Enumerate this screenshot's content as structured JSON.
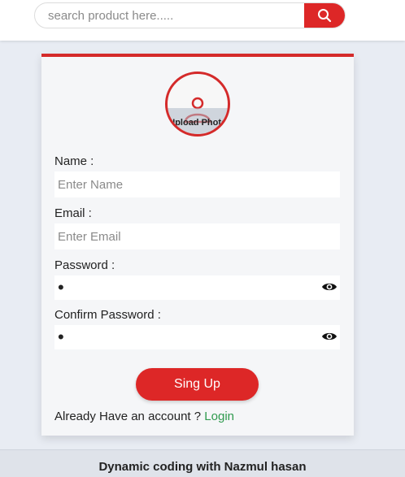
{
  "header": {
    "search": {
      "placeholder": "search product here....."
    }
  },
  "icons": {
    "search": "search-icon",
    "avatar": "user-icon",
    "toggle_password": "eye-icon"
  },
  "colors": {
    "accent": "#dd2727",
    "card_border": "#d42a2a",
    "link": "#2f9a4e",
    "page_background": "#e8ecf3"
  },
  "signup": {
    "upload_photo_label": "Upload Photo",
    "name": {
      "label": "Name :",
      "placeholder": "Enter Name",
      "value": ""
    },
    "email": {
      "label": "Email :",
      "placeholder": "Enter Email",
      "value": ""
    },
    "password": {
      "label": "Password :",
      "value": "•"
    },
    "confirm_password": {
      "label": "Confirm Password :",
      "value": "•"
    },
    "submit_label": "Sing Up",
    "login_prompt": "Already Have an account ?",
    "login_link": "Login"
  },
  "footer": {
    "text": "Dynamic coding with Nazmul hasan"
  }
}
